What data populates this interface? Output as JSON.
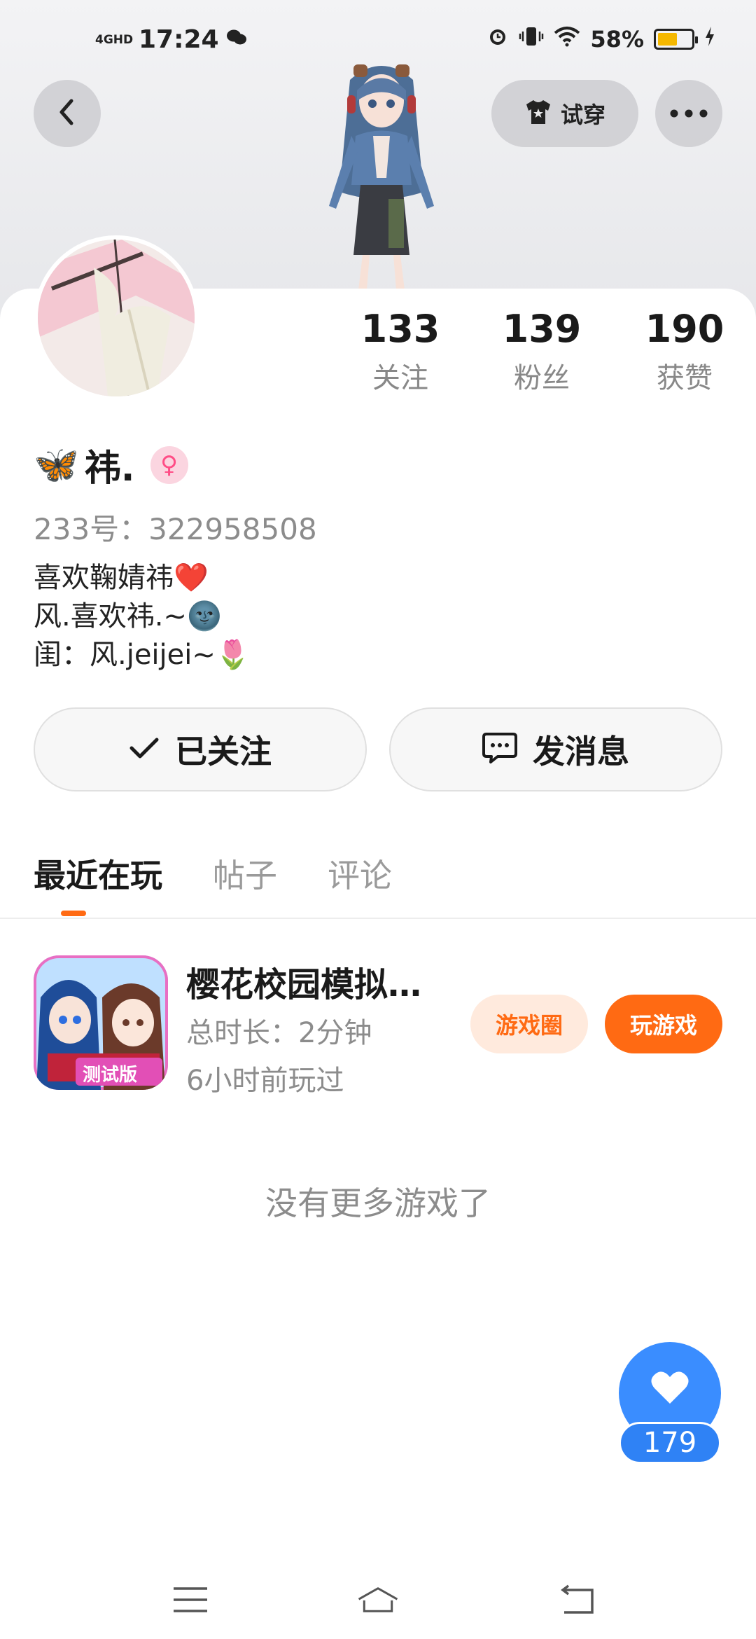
{
  "status_bar": {
    "network": "4GHD",
    "time": "17:24",
    "battery_percent": "58%",
    "battery_level": 0.58,
    "icons": [
      "wechat-icon",
      "alarm-icon",
      "vibrate-icon",
      "wifi-icon",
      "battery-icon",
      "charging-icon"
    ]
  },
  "header": {
    "tryon_label": "试穿"
  },
  "stats": [
    {
      "value": "133",
      "label": "关注"
    },
    {
      "value": "139",
      "label": "粉丝"
    },
    {
      "value": "190",
      "label": "获赞"
    }
  ],
  "profile": {
    "name": "祎.",
    "name_emoji": "🦋",
    "gender_symbol": "♀",
    "id_text": "233号：322958508",
    "bio": [
      "喜欢鞠婧祎❤️",
      "风.喜欢祎.~🌚",
      "闺：风.jeijei~🌷"
    ]
  },
  "actions": {
    "follow_label": "已关注",
    "message_label": "发消息"
  },
  "tabs": [
    {
      "label": "最近在玩",
      "active": true
    },
    {
      "label": "帖子",
      "active": false
    },
    {
      "label": "评论",
      "active": false
    }
  ],
  "games": [
    {
      "title": "樱花校园模拟…",
      "duration": "总时长：2分钟",
      "last_played": "6小时前玩过",
      "circle_label": "游戏圈",
      "play_label": "玩游戏",
      "icon_badge": "测试版"
    }
  ],
  "empty_text": "没有更多游戏了",
  "like": {
    "count": "179"
  },
  "colors": {
    "accent": "#ff6a13",
    "like_blue": "#3a8dff",
    "gender_pink": "#ff4d86"
  }
}
